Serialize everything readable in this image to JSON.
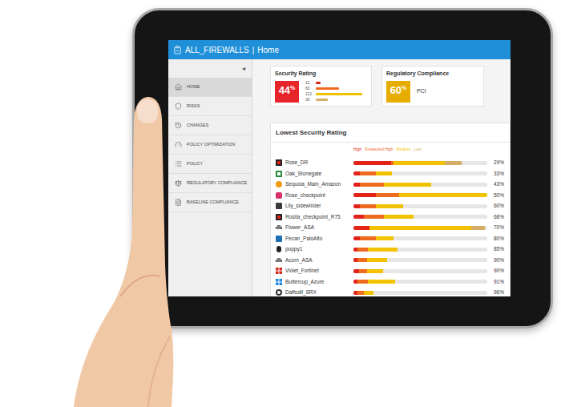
{
  "header": {
    "name": "ALL_FIREWALLS",
    "separator": "|",
    "page": "Home"
  },
  "sidebar": {
    "collapse": "◂",
    "items": [
      {
        "label": "HOME",
        "kind": "home",
        "selected": true
      },
      {
        "label": "RISKS",
        "kind": "risks",
        "selected": false
      },
      {
        "label": "CHANGES",
        "kind": "changes",
        "selected": false
      },
      {
        "label": "POLICY OPTIMIZATION",
        "kind": "optimization",
        "selected": false
      },
      {
        "label": "POLICY",
        "kind": "policy",
        "selected": false
      },
      {
        "label": "REGULATORY COMPLIANCE",
        "kind": "regulatory",
        "selected": false
      },
      {
        "label": "BASELINE COMPLIANCE",
        "kind": "baseline",
        "selected": false
      }
    ]
  },
  "security_rating": {
    "title": "Security Rating",
    "value": "44",
    "unit": "%",
    "breakdown": [
      {
        "count": "12",
        "severity": "high",
        "level": 0.1
      },
      {
        "count": "60",
        "severity": "suspected",
        "level": 0.5
      },
      {
        "count": "121",
        "severity": "medium",
        "level": 1
      },
      {
        "count": "30",
        "severity": "low",
        "level": 0.25
      }
    ]
  },
  "regulatory_compliance": {
    "title": "Regulatory Compliance",
    "value": "60",
    "unit": "%",
    "standard": "PCI"
  },
  "lowest": {
    "title": "Lowest Security Rating",
    "legend": [
      {
        "label": "High",
        "severity": "high",
        "color": "#e2231a"
      },
      {
        "label": "Suspected High",
        "severity": "suspected",
        "color": "#ee6a1f"
      },
      {
        "label": "Medium",
        "severity": "medium",
        "color": "#f2c200"
      },
      {
        "label": "Low",
        "severity": "low",
        "color": "#d6ad66"
      }
    ],
    "rows": [
      {
        "name": "Rose_DR",
        "kind": "generic",
        "percent": "29%",
        "segments": [
          {
            "severity": "high",
            "level": 0.28
          },
          {
            "severity": "suspected",
            "level": 0.02
          },
          {
            "severity": "medium",
            "level": 0.38
          },
          {
            "severity": "low",
            "level": 0.13
          }
        ]
      },
      {
        "name": "Oak_Stonegate",
        "kind": "stonegate",
        "percent": "33%",
        "segments": [
          {
            "severity": "high",
            "level": 0.05
          },
          {
            "severity": "suspected",
            "level": 0.12
          },
          {
            "severity": "medium",
            "level": 0.12
          },
          {
            "severity": "low",
            "level": 0
          }
        ]
      },
      {
        "name": "Sequoia_Main_Amazon",
        "kind": "amazon",
        "percent": "43%",
        "segments": [
          {
            "severity": "high",
            "level": 0.05
          },
          {
            "severity": "suspected",
            "level": 0.18
          },
          {
            "severity": "medium",
            "level": 0.35
          },
          {
            "severity": "low",
            "level": 0
          }
        ]
      },
      {
        "name": "Rose_checkpoint",
        "kind": "checkpoint",
        "percent": "50%",
        "segments": [
          {
            "severity": "high",
            "level": 0.17
          },
          {
            "severity": "suspected",
            "level": 0.17
          },
          {
            "severity": "medium",
            "level": 0.66
          },
          {
            "severity": "low",
            "level": 0
          }
        ]
      },
      {
        "name": "Lily_sidewinder",
        "kind": "sidewinder",
        "percent": "60%",
        "segments": [
          {
            "severity": "high",
            "level": 0.05
          },
          {
            "severity": "suspected",
            "level": 0.12
          },
          {
            "severity": "medium",
            "level": 0.2
          },
          {
            "severity": "low",
            "level": 0
          }
        ]
      },
      {
        "name": "Rosita_checkpoint_R75",
        "kind": "generic",
        "percent": "68%",
        "segments": [
          {
            "severity": "high",
            "level": 0.08
          },
          {
            "severity": "suspected",
            "level": 0.15
          },
          {
            "severity": "medium",
            "level": 0.22
          },
          {
            "severity": "low",
            "level": 0
          }
        ]
      },
      {
        "name": "Flower_ASA",
        "kind": "cisco",
        "percent": "70%",
        "segments": [
          {
            "severity": "high",
            "level": 0.12
          },
          {
            "severity": "suspected",
            "level": 0
          },
          {
            "severity": "medium",
            "level": 0.76
          },
          {
            "severity": "low",
            "level": 0.1
          }
        ]
      },
      {
        "name": "Pecan_PaloAlto",
        "kind": "paloalto",
        "percent": "80%",
        "segments": [
          {
            "severity": "high",
            "level": 0.05
          },
          {
            "severity": "suspected",
            "level": 0.12
          },
          {
            "severity": "medium",
            "level": 0.13
          },
          {
            "severity": "low",
            "level": 0
          }
        ]
      },
      {
        "name": "poppy1",
        "kind": "linux",
        "percent": "85%",
        "segments": [
          {
            "severity": "high",
            "level": 0.03
          },
          {
            "severity": "suspected",
            "level": 0.08
          },
          {
            "severity": "medium",
            "level": 0.22
          },
          {
            "severity": "low",
            "level": 0
          }
        ]
      },
      {
        "name": "Acorn_ASA",
        "kind": "cisco",
        "percent": "90%",
        "segments": [
          {
            "severity": "high",
            "level": 0.03
          },
          {
            "severity": "suspected",
            "level": 0.07
          },
          {
            "severity": "medium",
            "level": 0.15
          },
          {
            "severity": "low",
            "level": 0
          }
        ]
      },
      {
        "name": "Violet_Fortinet",
        "kind": "fortinet",
        "percent": "90%",
        "segments": [
          {
            "severity": "high",
            "level": 0.04
          },
          {
            "severity": "suspected",
            "level": 0.06
          },
          {
            "severity": "medium",
            "level": 0.12
          },
          {
            "severity": "low",
            "level": 0
          }
        ]
      },
      {
        "name": "Buttercup_Azure",
        "kind": "azure",
        "percent": "91%",
        "segments": [
          {
            "severity": "high",
            "level": 0.03
          },
          {
            "severity": "suspected",
            "level": 0.08
          },
          {
            "severity": "medium",
            "level": 0.2
          },
          {
            "severity": "low",
            "level": 0
          }
        ]
      },
      {
        "name": "Daffodil_SRX",
        "kind": "juniper",
        "percent": "96%",
        "segments": [
          {
            "severity": "high",
            "level": 0.03
          },
          {
            "severity": "suspected",
            "level": 0.05
          },
          {
            "severity": "medium",
            "level": 0.07
          },
          {
            "severity": "low",
            "level": 0
          }
        ]
      }
    ]
  }
}
